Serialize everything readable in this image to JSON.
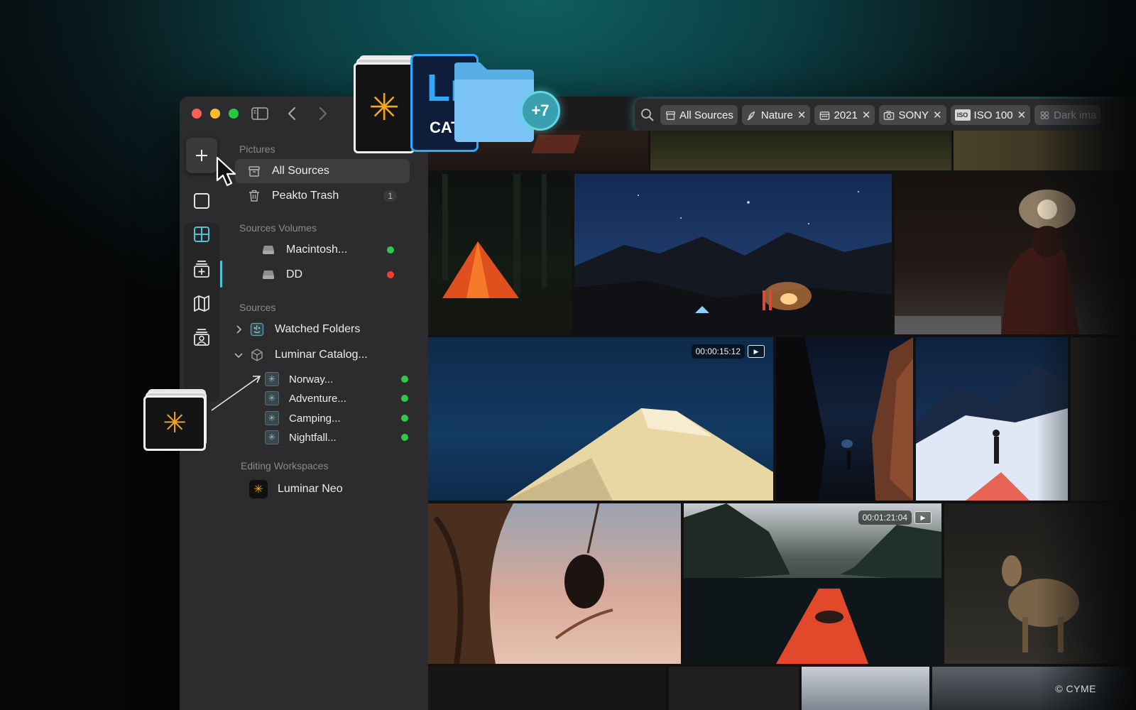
{
  "floating": {
    "lr_label_top": "Lr",
    "lr_label_bottom": "CAT",
    "more_count": "+7"
  },
  "filter_chips": [
    {
      "icon": "archive-icon",
      "label": "All Sources",
      "removable": false
    },
    {
      "icon": "nature-icon",
      "label": "Nature",
      "removable": true
    },
    {
      "icon": "calendar-icon",
      "label": "2021",
      "removable": true
    },
    {
      "icon": "camera-icon",
      "label": "SONY",
      "removable": true
    },
    {
      "icon": "iso-icon",
      "icon_text": "ISO",
      "label": "ISO 100",
      "removable": true
    },
    {
      "icon": "scene-icon",
      "label": "Dark ima",
      "removable": false
    }
  ],
  "sidebar": {
    "pictures_header": "Pictures",
    "all_sources": "All Sources",
    "trash": "Peakto Trash",
    "trash_count": "1",
    "volumes_header": "Sources Volumes",
    "volumes": [
      {
        "label": "Macintosh...",
        "status_color": "#2fc94a"
      },
      {
        "label": "DD",
        "status_color": "#ff3b30"
      }
    ],
    "sources_header": "Sources",
    "watched_folders": "Watched Folders",
    "luminar_catalog": "Luminar Catalog...",
    "catalogs": [
      {
        "label": "Norway...",
        "status_color": "#2fc94a"
      },
      {
        "label": "Adventure...",
        "status_color": "#2fc94a"
      },
      {
        "label": "Camping...",
        "status_color": "#2fc94a"
      },
      {
        "label": "Nightfall...",
        "status_color": "#2fc94a"
      }
    ],
    "workspaces_header": "Editing Workspaces",
    "workspace": "Luminar Neo"
  },
  "videos": [
    {
      "duration": "00:00:15:12"
    },
    {
      "duration": "00:01:21:04"
    }
  ],
  "colors": {
    "accent": "#4fc3d1",
    "luminar_orange": "#f5a623",
    "lightroom_blue": "#31a8ff"
  },
  "copyright": "© CYME"
}
